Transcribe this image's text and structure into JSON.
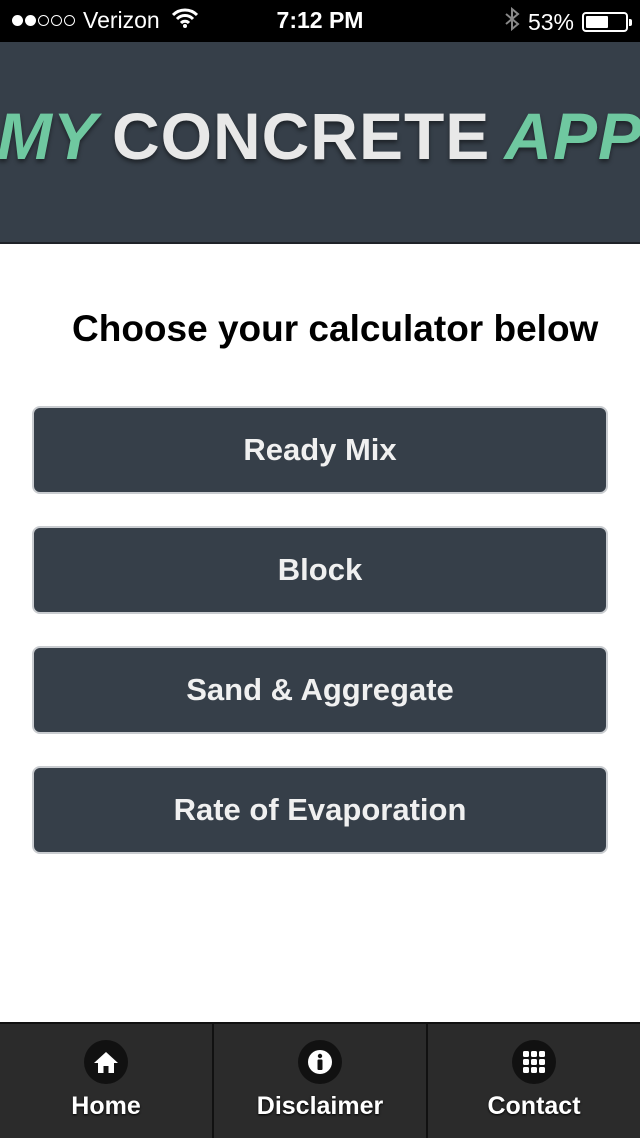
{
  "status_bar": {
    "carrier": "Verizon",
    "time": "7:12 PM",
    "battery_percent": "53%",
    "battery_level": 0.53,
    "signal_strength": 2,
    "signal_max": 5,
    "icons": [
      "wifi-icon",
      "bluetooth-icon",
      "battery-icon"
    ]
  },
  "header": {
    "logo_word_1": "MY",
    "logo_word_2": "CONCRETE",
    "logo_word_3": "APP",
    "colors": {
      "background": "#363f49",
      "accent": "#6fc8a0",
      "text": "#e8e8e8"
    }
  },
  "main": {
    "heading": "Choose your calculator below",
    "calculators": [
      {
        "label": "Ready Mix"
      },
      {
        "label": "Block"
      },
      {
        "label": "Sand & Aggregate"
      },
      {
        "label": "Rate of Evaporation"
      }
    ]
  },
  "bottom_nav": {
    "items": [
      {
        "label": "Home",
        "icon": "home-icon"
      },
      {
        "label": "Disclaimer",
        "icon": "info-icon"
      },
      {
        "label": "Contact",
        "icon": "grid-icon"
      }
    ]
  }
}
